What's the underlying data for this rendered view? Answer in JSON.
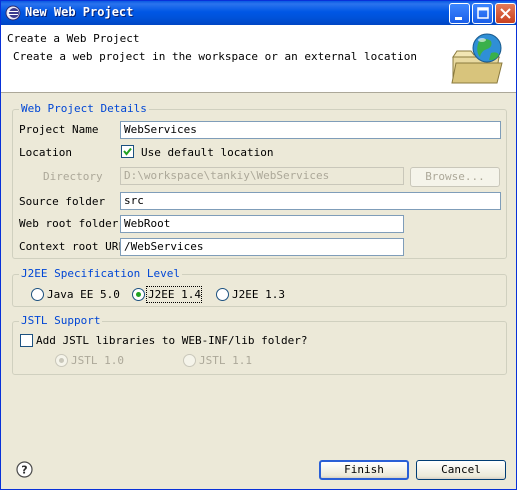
{
  "window": {
    "title": "New Web Project"
  },
  "header": {
    "title": "Create a Web Project",
    "description": "Create a web project in the workspace or an external location"
  },
  "details": {
    "group_label": "Web Project Details",
    "project_name_label": "Project Name",
    "project_name_value": "WebServices",
    "location_label": "Location",
    "use_default_label": "Use default location",
    "use_default_checked": true,
    "directory_label": "Directory",
    "directory_value": "D:\\workspace\\tankiy\\WebServices",
    "browse_label": "Browse...",
    "source_folder_label": "Source folder",
    "source_folder_value": "src",
    "web_root_label": "Web root folder",
    "web_root_value": "WebRoot",
    "context_root_label": "Context root URL",
    "context_root_value": "/WebServices"
  },
  "j2ee": {
    "group_label": "J2EE Specification Level",
    "options": [
      {
        "label": "Java EE 5.0",
        "selected": false
      },
      {
        "label": "J2EE 1.4",
        "selected": true
      },
      {
        "label": "J2EE 1.3",
        "selected": false
      }
    ]
  },
  "jstl": {
    "group_label": "JSTL Support",
    "add_label": "Add JSTL libraries to WEB-INF/lib folder?",
    "add_checked": false,
    "options": [
      {
        "label": "JSTL 1.0",
        "selected": true
      },
      {
        "label": "JSTL 1.1",
        "selected": false
      }
    ]
  },
  "footer": {
    "finish_label": "Finish",
    "cancel_label": "Cancel"
  },
  "colors": {
    "titlebar": "#0054e3",
    "group_label": "#0046d5",
    "dialog_bg": "#ece9d8"
  }
}
